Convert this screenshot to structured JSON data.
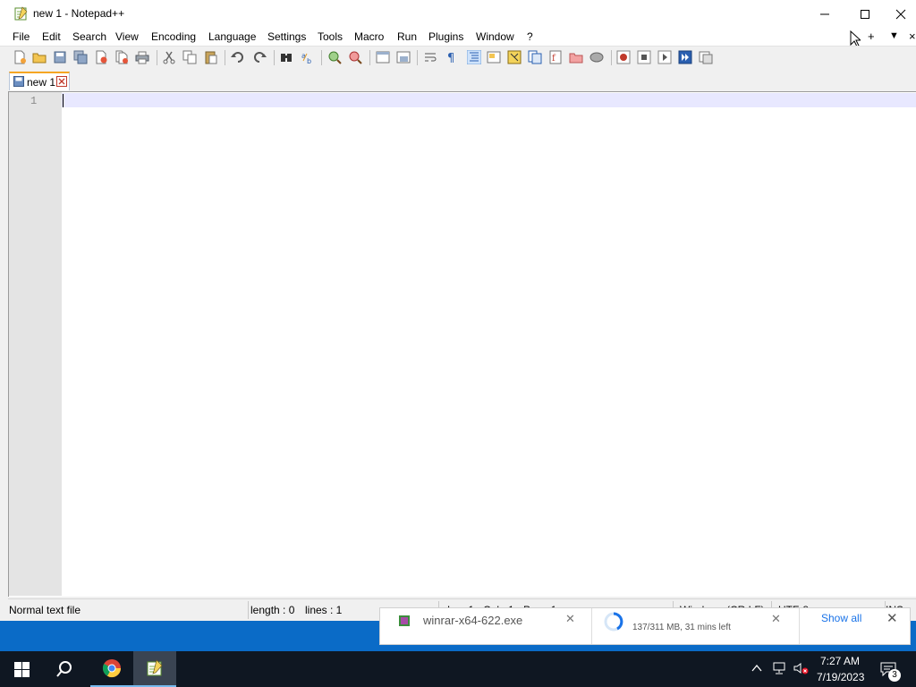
{
  "window": {
    "title": "new 1 - Notepad++"
  },
  "menu": {
    "file": "File",
    "edit": "Edit",
    "search": "Search",
    "view": "View",
    "encoding": "Encoding",
    "language": "Language",
    "settings": "Settings",
    "tools": "Tools",
    "macro": "Macro",
    "run": "Run",
    "plugins": "Plugins",
    "window": "Window",
    "help": "?",
    "plus": "+",
    "dropdown": "▼",
    "close": "×"
  },
  "tab": {
    "label": "new 1"
  },
  "editor": {
    "line_number": "1"
  },
  "status": {
    "file_type": "Normal text file",
    "length": "length : 0",
    "lines": "lines : 1",
    "ln": "Ln : 1",
    "col": "Col : 1",
    "pos": "Pos : 1",
    "eol": "Windows (CR LF)",
    "encoding": "UTF-8",
    "mode": "INS"
  },
  "download": {
    "filename": "winrar-x64-622.exe",
    "progress": "137/311 MB, 31 mins left",
    "show_all": "Show all"
  },
  "tray": {
    "time": "7:27 AM",
    "date": "7/19/2023",
    "notifications": "3"
  },
  "colors": {
    "accent": "#0078d7",
    "taskbar": "#0f1722",
    "desktop": "#0a6bc7",
    "current_line": "#e8e8ff",
    "tab_accent": "#f5a623"
  }
}
